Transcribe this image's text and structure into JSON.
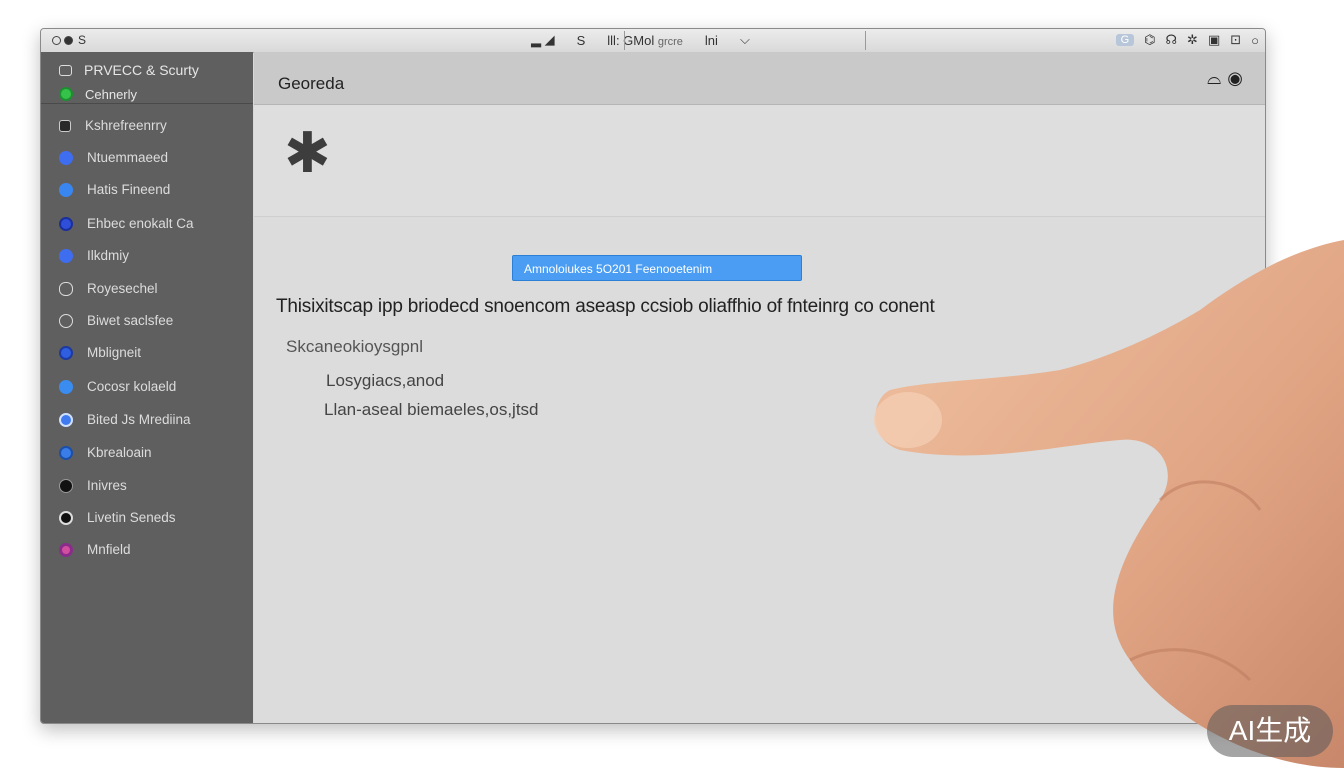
{
  "titlebar": {
    "left_label": "S",
    "center_items": [
      "S",
      "lll: GMol"
    ],
    "field_hint": "grcre",
    "field_value": "lni",
    "badge": "G",
    "right_icons": [
      "g-icon",
      "headphone-icon",
      "network-icon",
      "calendar-icon",
      "lock-icon",
      "power-icon"
    ]
  },
  "sidebar": {
    "header": {
      "title": "PRVECC & Scurty",
      "subtitle": "Cehnerly"
    },
    "items": [
      {
        "label": "Kshrefreenrry",
        "icon_color": "#2a2a2a"
      },
      {
        "label": "Ntuemmaeed",
        "icon_color": "#3f6df0"
      },
      {
        "label": "Hatis Fineend",
        "icon_color": "#3a86f0"
      },
      {
        "label": "Ehbec enokalt Ca",
        "icon_color": "#2f4fd8"
      },
      {
        "label": "Ilkdmiy",
        "icon_color": "#3f6df0"
      },
      {
        "label": "Royesechel",
        "icon_color": "#5f5f5f"
      },
      {
        "label": "Biwet saclsfee",
        "icon_color": "#5f5f5f"
      },
      {
        "label": "Mbligneit",
        "icon_color": "#2f5fe0"
      },
      {
        "label": "Cocosr kolaeld",
        "icon_color": "#3a8cf0"
      },
      {
        "label": "Bited Js Mrediina",
        "icon_color": "#3f7af0"
      },
      {
        "label": "Kbrealoain",
        "icon_color": "#3a7de8"
      },
      {
        "label": "Inivres",
        "icon_color": "#111111"
      },
      {
        "label": "Livetin Seneds",
        "icon_color": "#111111"
      },
      {
        "label": "Mnfield",
        "icon_color": "#d24fa0"
      }
    ]
  },
  "main": {
    "title": "Georeda",
    "blue_bar": "Amnoloiukes 5O201  Feenooetenim",
    "body_text": "Thisixitscap ipp briodecd snoencom aseasp ccsiob oliaffhio of fnteinrg co conent",
    "sub1": "Skcaneokioysgpnl",
    "sub2": "Losygiacs,anod",
    "sub3": "Llan-aseal biemaeles,os,jtsd"
  },
  "watermark": "AI生成",
  "colors": {
    "sidebar_bg": "#5f5f5f",
    "accent_blue": "#4a9df2",
    "content_bg": "#dcdcdc"
  }
}
